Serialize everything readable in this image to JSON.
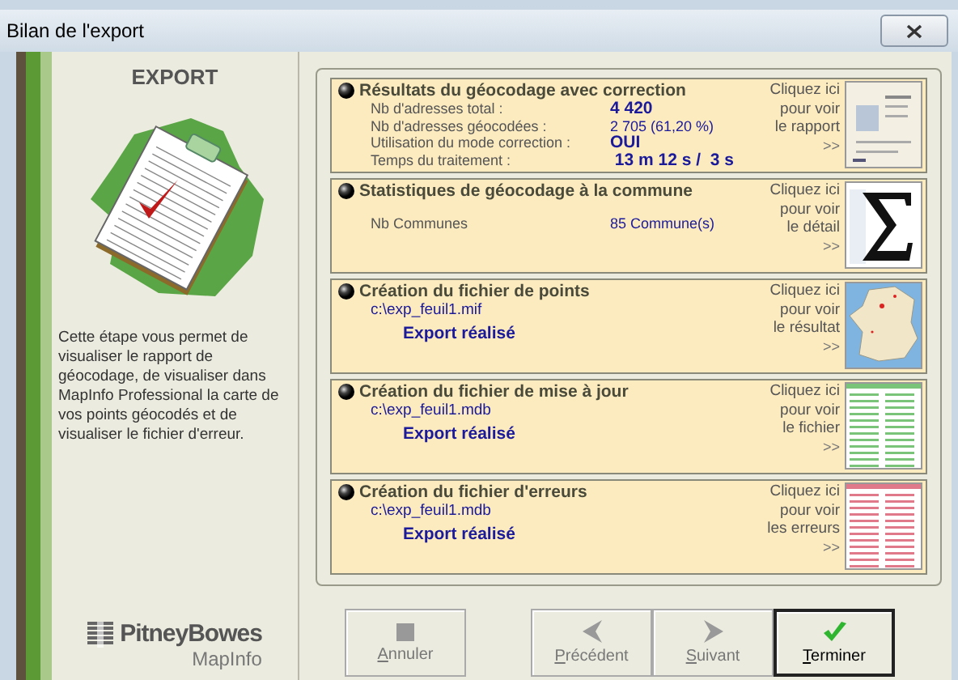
{
  "window": {
    "title": "Bilan de l'export"
  },
  "sidebar": {
    "heading": "EXPORT",
    "description": "Cette étape vous permet de visualiser le rapport de géocodage, de visualiser dans MapInfo Professional la carte de vos points géocodés et de visualiser le fichier d'erreur.",
    "logo_name": "PitneyBowes",
    "logo_product": "MapInfo"
  },
  "sections": [
    {
      "title": "Résultats du géocodage avec correction",
      "kind": "stats",
      "rows": [
        {
          "label": "Nb d'adresses total :",
          "value": "4 420",
          "bold": true
        },
        {
          "label": "Nb d'adresses géocodées :",
          "value": "2 705 (61,20 %)",
          "bold": false
        },
        {
          "label": "Utilisation du mode correction :",
          "value": "OUI",
          "bold": true
        },
        {
          "label": "Temps du traitement :",
          "value": " 13 m 12 s /  3 s",
          "bold": true
        }
      ],
      "link": [
        "Cliquez ici",
        "pour voir",
        "le rapport"
      ],
      "more": ">>"
    },
    {
      "title": "Statistiques de géocodage à la commune",
      "kind": "stats",
      "rows": [
        {
          "label": "Nb Communes",
          "value": "85 Commune(s)",
          "bold": false
        }
      ],
      "link": [
        "Cliquez ici",
        "pour voir",
        "le détail"
      ],
      "more": ">>"
    },
    {
      "title": "Création du fichier de points",
      "kind": "file",
      "path": "c:\\exp_feuil1.mif",
      "status": "Export réalisé",
      "link": [
        "Cliquez ici",
        "pour voir",
        "le résultat"
      ],
      "more": ">>"
    },
    {
      "title": "Création du fichier de mise à jour",
      "kind": "file",
      "path": "c:\\exp_feuil1.mdb",
      "status": "Export réalisé",
      "link": [
        "Cliquez ici",
        "pour voir",
        "le fichier"
      ],
      "more": ">>"
    },
    {
      "title": "Création du fichier d'erreurs",
      "kind": "file",
      "path": "c:\\exp_feuil1.mdb",
      "status": "Export réalisé",
      "link": [
        "Cliquez ici",
        "pour voir",
        "les erreurs"
      ],
      "more": ">>"
    }
  ],
  "buttons": [
    {
      "label": "Annuler",
      "disabled": true,
      "default": false
    },
    {
      "label": "Précédent",
      "disabled": true,
      "default": false
    },
    {
      "label": "Suivant",
      "disabled": true,
      "default": false
    },
    {
      "label": "Terminer",
      "disabled": false,
      "default": true
    }
  ]
}
